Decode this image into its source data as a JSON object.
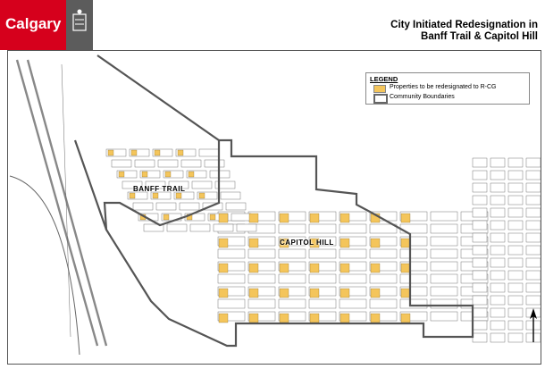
{
  "header": {
    "brand": "Calgary",
    "title_line1": "City Initiated Redesignation in",
    "title_line2": "Banff Trail & Capitol Hill"
  },
  "legend": {
    "title": "LEGEND",
    "items": [
      {
        "label": "Properties to be redesignated to R-CG",
        "color": "#f4c55b"
      },
      {
        "label": "Community Boundaries",
        "color": "#666666"
      }
    ]
  },
  "map": {
    "community_labels": [
      "BANFF TRAIL",
      "CAPITOL HILL"
    ],
    "colors": {
      "property": "#f4c55b",
      "boundary": "#555555",
      "brand": "#d6001c"
    }
  }
}
